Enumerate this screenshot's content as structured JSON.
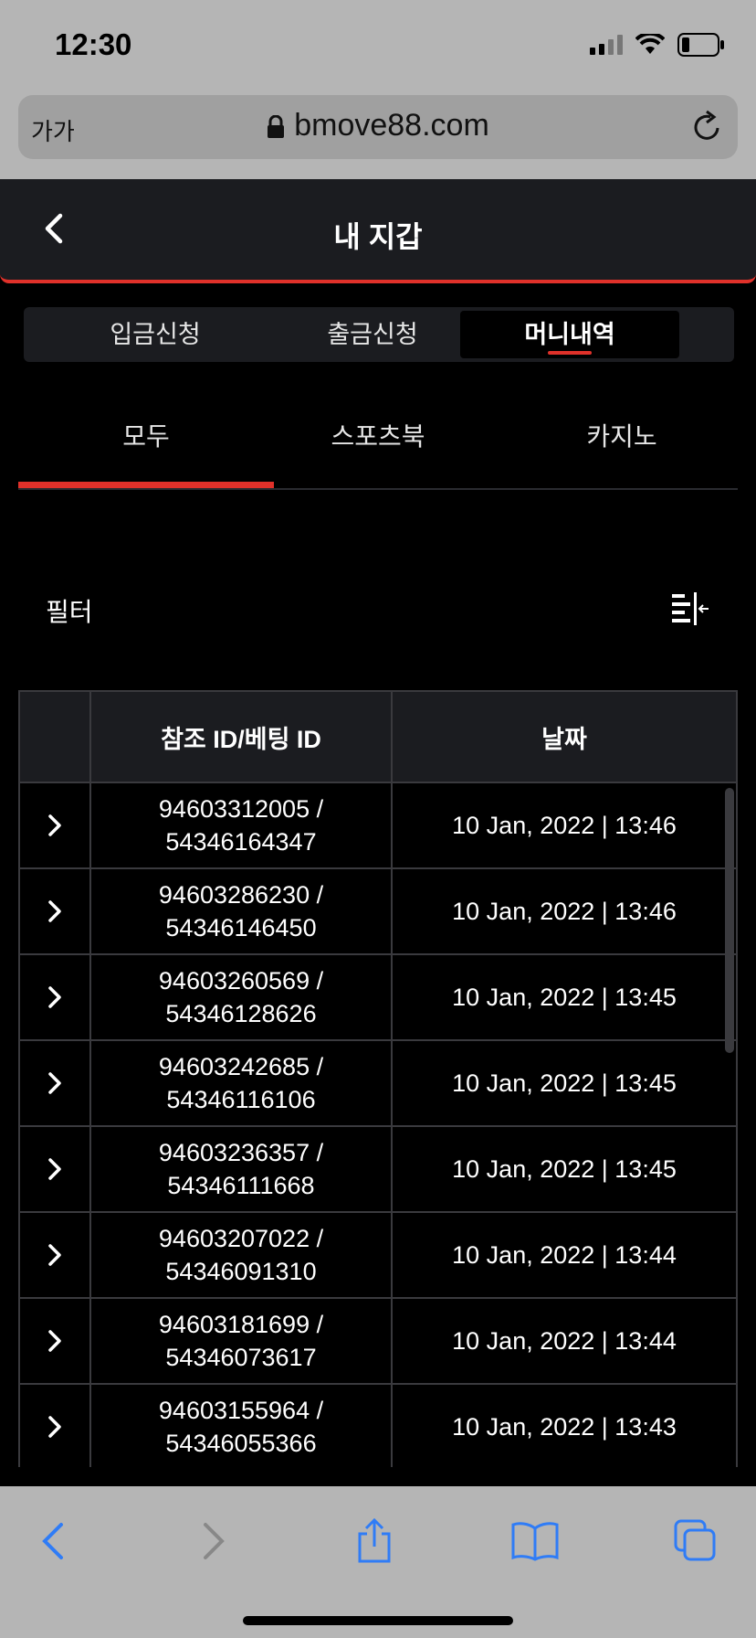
{
  "status": {
    "time": "12:30"
  },
  "browser": {
    "aa_label": "가가",
    "url": "bmove88.com"
  },
  "header": {
    "title": "내 지갑"
  },
  "segments": [
    {
      "label": "입금신청",
      "active": false
    },
    {
      "label": "출금신청",
      "active": false
    },
    {
      "label": "머니내역",
      "active": true
    }
  ],
  "sub_tabs": [
    {
      "label": "모두",
      "active": true
    },
    {
      "label": "스포츠북",
      "active": false
    },
    {
      "label": "카지노",
      "active": false
    }
  ],
  "filter": {
    "label": "필터",
    "icon": "filter-sort-icon"
  },
  "table": {
    "headers": {
      "ref_id": "참조 ID/베팅 ID",
      "date": "날짜"
    },
    "rows": [
      {
        "ref_id": "94603312005 /",
        "bet_id": "54346164347",
        "date": "10 Jan, 2022 | 13:46"
      },
      {
        "ref_id": "94603286230 /",
        "bet_id": "54346146450",
        "date": "10 Jan, 2022 | 13:46"
      },
      {
        "ref_id": "94603260569 /",
        "bet_id": "54346128626",
        "date": "10 Jan, 2022 | 13:45"
      },
      {
        "ref_id": "94603242685 /",
        "bet_id": "54346116106",
        "date": "10 Jan, 2022 | 13:45"
      },
      {
        "ref_id": "94603236357 /",
        "bet_id": "54346111668",
        "date": "10 Jan, 2022 | 13:45"
      },
      {
        "ref_id": "94603207022 /",
        "bet_id": "54346091310",
        "date": "10 Jan, 2022 | 13:44"
      },
      {
        "ref_id": "94603181699 /",
        "bet_id": "54346073617",
        "date": "10 Jan, 2022 | 13:44"
      },
      {
        "ref_id": "94603155964 /",
        "bet_id": "54346055366",
        "date": "10 Jan, 2022 | 13:43"
      }
    ]
  },
  "colors": {
    "accent": "#e0312a",
    "toolbar_blue": "#2f7cf6",
    "header_bg": "#1b1c20"
  }
}
